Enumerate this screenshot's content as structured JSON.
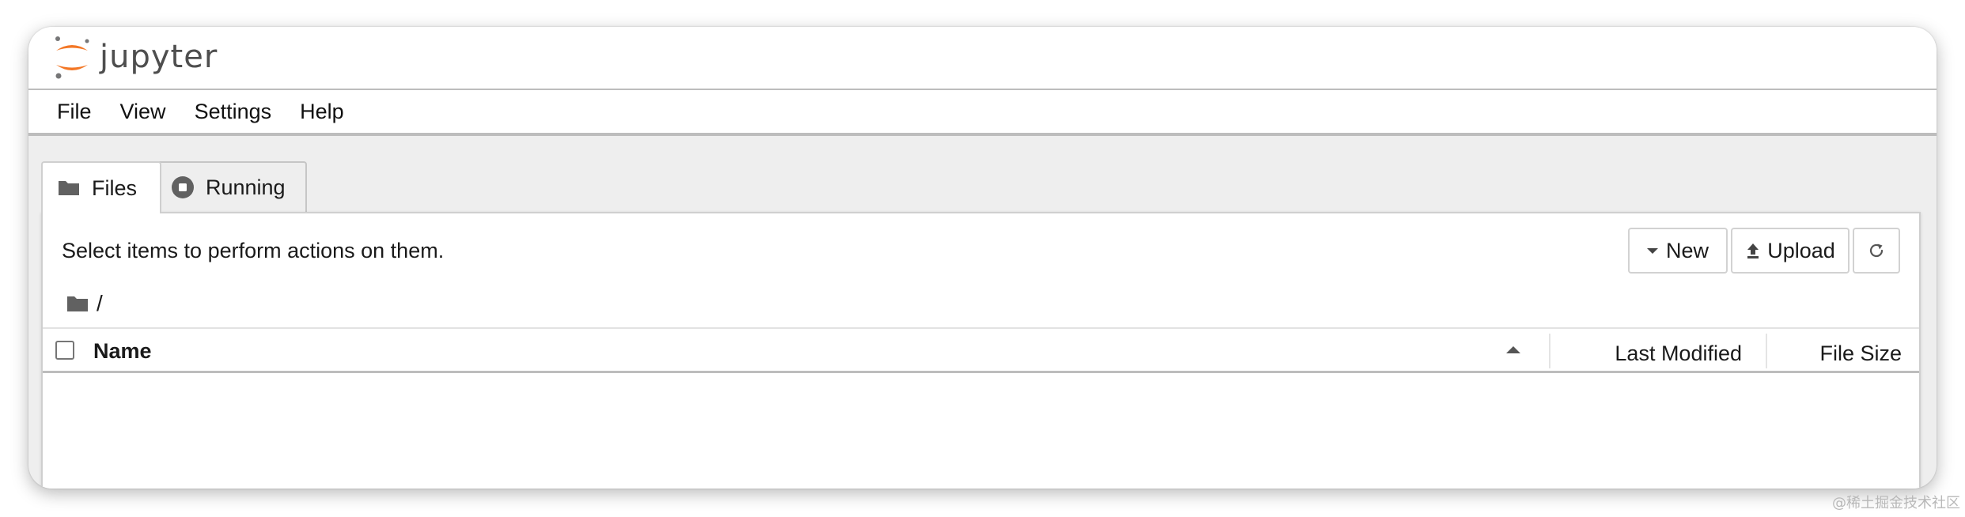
{
  "app": {
    "name": "jupyter"
  },
  "menu": [
    "File",
    "View",
    "Settings",
    "Help"
  ],
  "tabs": [
    {
      "label": "Files",
      "icon": "folder-icon",
      "active": true
    },
    {
      "label": "Running",
      "icon": "stop-circle-icon",
      "active": false
    }
  ],
  "toolbar": {
    "hint": "Select items to perform actions on them.",
    "new_label": "New",
    "upload_label": "Upload",
    "refresh_icon": "refresh-icon"
  },
  "breadcrumb": {
    "path": "/"
  },
  "file_list": {
    "columns": {
      "name": "Name",
      "last_modified": "Last Modified",
      "file_size": "File Size"
    },
    "sort": {
      "column": "Name",
      "direction": "ascending"
    },
    "rows": []
  },
  "watermark": "@稀土掘金技术社区",
  "colors": {
    "logo_orange": "#f37726",
    "logo_gray": "#767677",
    "accent": "#616161"
  }
}
